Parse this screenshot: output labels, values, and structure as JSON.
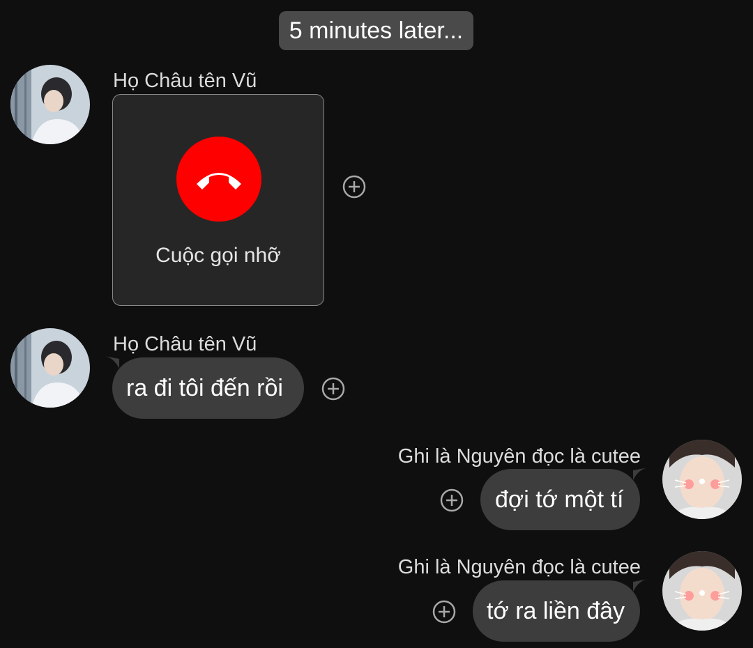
{
  "divider": {
    "text": "5 minutes later..."
  },
  "messages": [
    {
      "sender": "Họ Châu tên Vũ",
      "call_label": "Cuộc gọi nhỡ"
    },
    {
      "sender": "Họ Châu tên Vũ",
      "text": "ra đi tôi đến rồi"
    },
    {
      "sender": "Ghi là Nguyên đọc là cutee",
      "text": "đợi tớ một tí"
    },
    {
      "sender": "Ghi là Nguyên đọc là cutee",
      "text": "tớ ra liền đây"
    }
  ],
  "colors": {
    "background": "#0f0f0f",
    "bubble": "#3d3d3d",
    "divider": "#4a4a4a",
    "missed_call": "#ff0000"
  },
  "icons": {
    "reaction": "add-reaction-icon",
    "call": "phone-hangup-icon"
  }
}
